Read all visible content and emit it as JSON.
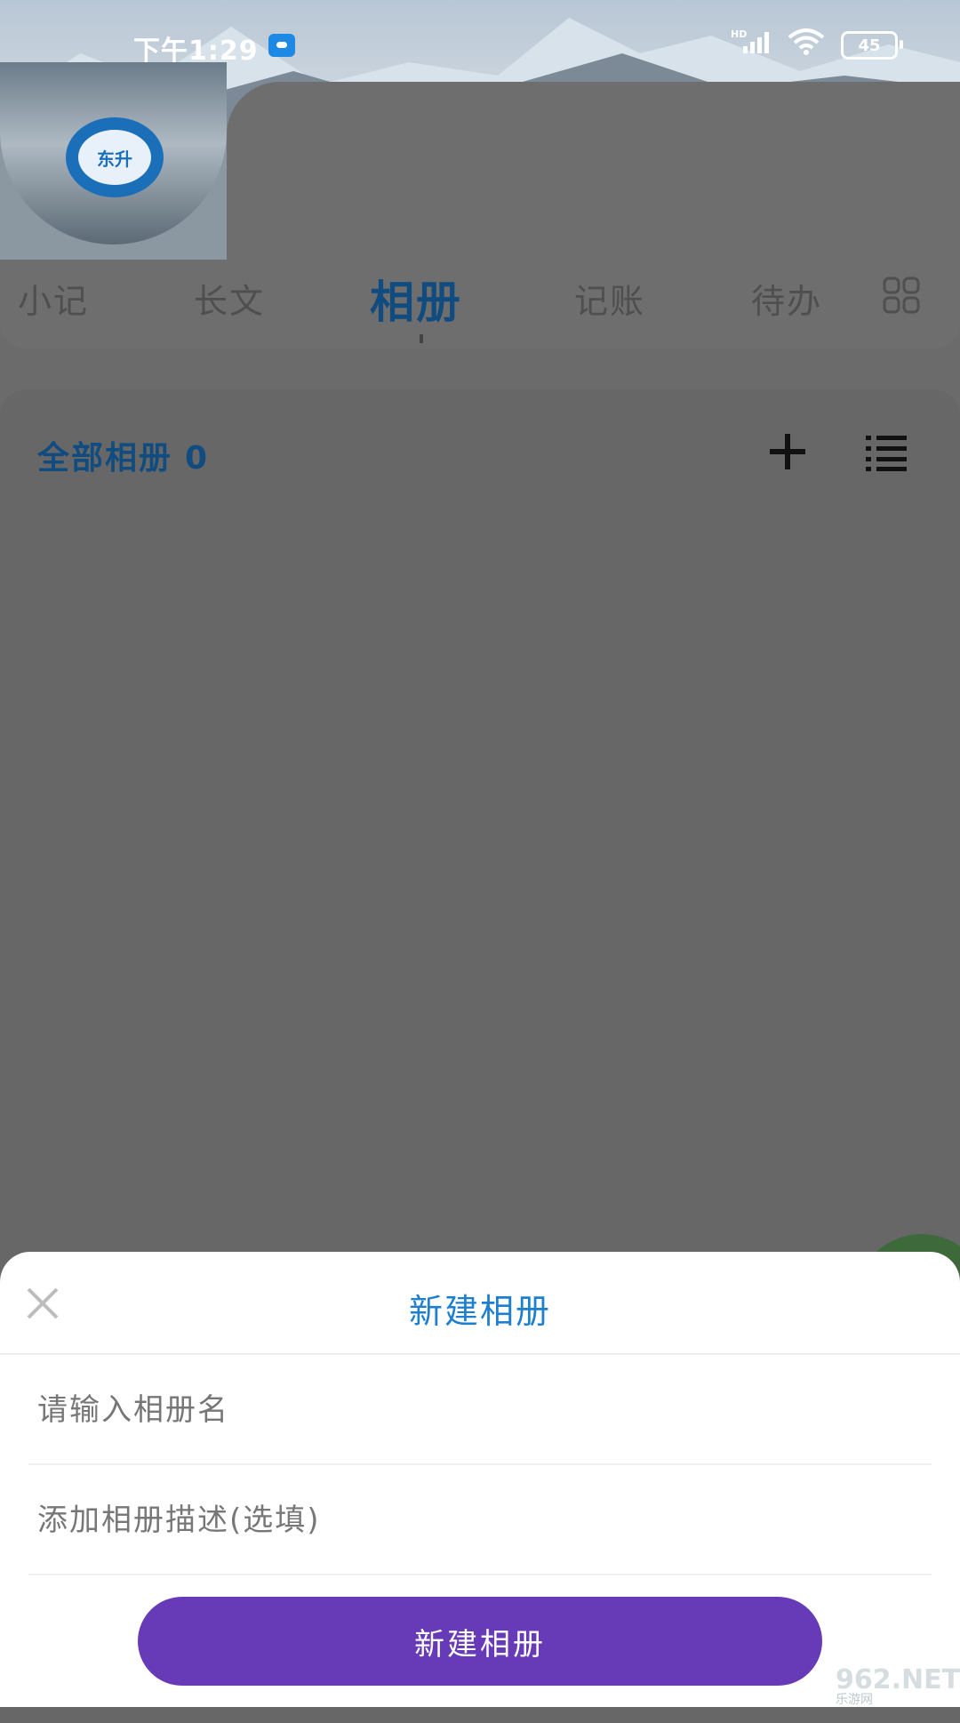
{
  "status_bar": {
    "time": "下午1:29",
    "network": "HD",
    "battery": "45"
  },
  "profile": {
    "logo_text": "东升"
  },
  "tabs": [
    {
      "label": "小记",
      "active": false
    },
    {
      "label": "长文",
      "active": false
    },
    {
      "label": "相册",
      "active": true
    },
    {
      "label": "记账",
      "active": false
    },
    {
      "label": "待办",
      "active": false
    }
  ],
  "album": {
    "title": "全部相册",
    "count": "0"
  },
  "sheet": {
    "title": "新建相册",
    "name_placeholder": "请输入相册名",
    "desc_placeholder": "添加相册描述(选填)",
    "submit_label": "新建相册"
  },
  "watermark": {
    "text": "962.NET",
    "subtext": "乐游网"
  },
  "colors": {
    "accent_blue": "#1f7fcf",
    "dark_blue": "#114c80",
    "button_purple": "#673ab7",
    "overlay": "#6b6b6b"
  }
}
